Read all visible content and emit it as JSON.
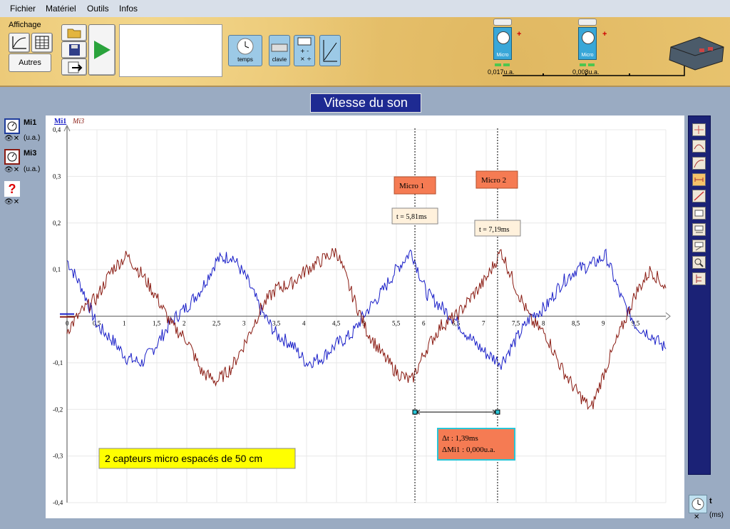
{
  "menu": {
    "items": [
      "Fichier",
      "Matériel",
      "Outils",
      "Infos"
    ]
  },
  "toolbar": {
    "affichage_label": "Affichage",
    "autres_label": "Autres",
    "temps_label": "temps",
    "clavier_label": "clavie",
    "sensors": [
      {
        "name": "Micro",
        "value": "0,017u.a."
      },
      {
        "name": "Micro",
        "value": "0,008u.a."
      }
    ]
  },
  "graph_title": "Vitesse du son",
  "left_panel": {
    "channels": [
      {
        "name": "Mi1",
        "unit": "(u.a.)"
      },
      {
        "name": "Mi3",
        "unit": "(u.a.)"
      }
    ],
    "unknown": "?"
  },
  "time_panel": {
    "name": "t",
    "unit": "(ms)"
  },
  "chart_data": {
    "type": "line",
    "xlabel": "t (ms)",
    "ylabel": "",
    "legend": [
      "Mi1",
      "Mi3"
    ],
    "xlim": [
      0,
      10
    ],
    "ylim": [
      -0.4,
      0.4
    ],
    "x_ticks": [
      "0,5",
      "1",
      "1,5",
      "2",
      "2,5",
      "3",
      "3,5",
      "4",
      "4,5",
      "5",
      "5,5",
      "6",
      "6,5",
      "7",
      "7,5",
      "8",
      "8,5",
      "9",
      "9,5"
    ],
    "y_ticks": [
      "0,4",
      "0,3",
      "0,2",
      "0,1",
      "-0,1",
      "-0,2",
      "-0,3",
      "-0,4"
    ],
    "origin_label": "0",
    "series": [
      {
        "name": "Mi1",
        "color": "#1a1fc8",
        "x": [
          0,
          0.25,
          0.5,
          0.75,
          1,
          1.25,
          1.5,
          1.75,
          2,
          2.25,
          2.5,
          2.75,
          3,
          3.25,
          3.5,
          3.75,
          4,
          4.25,
          4.5,
          4.75,
          5,
          5.25,
          5.5,
          5.75,
          6,
          6.25,
          6.5,
          6.75,
          7,
          7.25,
          7.5,
          7.75,
          8,
          8.25,
          8.5,
          8.75,
          9,
          9.25,
          9.5,
          9.75,
          10
        ],
        "values": [
          0.12,
          0.06,
          -0.02,
          -0.05,
          -0.09,
          -0.1,
          -0.06,
          -0.01,
          0.02,
          0.06,
          0.12,
          0.13,
          0.08,
          0.01,
          -0.04,
          -0.06,
          -0.1,
          -0.09,
          -0.06,
          -0.04,
          0.01,
          0.05,
          0.1,
          0.14,
          0.05,
          0.02,
          -0.01,
          -0.05,
          -0.08,
          -0.1,
          -0.05,
          0,
          0.02,
          0.07,
          0.1,
          0.11,
          0.13,
          0.04,
          -0.02,
          -0.04,
          -0.07
        ]
      },
      {
        "name": "Mi3",
        "color": "#8a1b12",
        "x": [
          0,
          0.25,
          0.5,
          0.75,
          1,
          1.25,
          1.5,
          1.75,
          2,
          2.25,
          2.5,
          2.75,
          3,
          3.25,
          3.5,
          3.75,
          4,
          4.25,
          4.5,
          4.75,
          5,
          5.25,
          5.5,
          5.75,
          6,
          6.25,
          6.5,
          6.75,
          7,
          7.25,
          7.5,
          7.75,
          8,
          8.25,
          8.5,
          8.75,
          9,
          9.25,
          9.5,
          9.75,
          10
        ],
        "values": [
          -0.03,
          0.01,
          0.04,
          0.1,
          0.13,
          0.09,
          0.04,
          -0.02,
          -0.05,
          -0.12,
          -0.14,
          -0.11,
          -0.05,
          0.02,
          0.06,
          0.07,
          0.1,
          0.12,
          0.14,
          0.05,
          -0.03,
          -0.08,
          -0.12,
          -0.14,
          -0.07,
          -0.02,
          0,
          0.04,
          0.08,
          0.14,
          0.06,
          -0.01,
          -0.04,
          -0.11,
          -0.16,
          -0.2,
          -0.11,
          -0.03,
          0.05,
          0.1,
          0.06
        ]
      }
    ],
    "cursors": [
      {
        "x": 5.81,
        "label": "Micro 1",
        "value": "t = 5,81ms"
      },
      {
        "x": 7.19,
        "label": "Micro 2",
        "value": "t = 7,19ms"
      }
    ],
    "delta": {
      "dt": "Δt : 1,39ms",
      "dm": "ΔMi1 : 0,000u.a."
    },
    "annotation": "2 capteurs micro espacés de 50 cm"
  }
}
